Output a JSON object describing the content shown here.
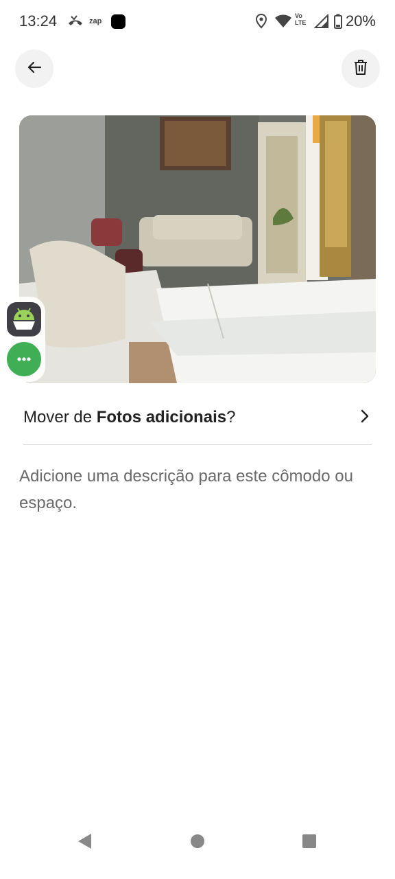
{
  "status_bar": {
    "time": "13:24",
    "notif_icons": [
      "missed-call-icon",
      "zap-icon",
      "app-square-icon"
    ],
    "zap_label": "zap",
    "system_icons": [
      "location-icon",
      "wifi-icon",
      "volte-icon",
      "signal-icon",
      "battery-icon"
    ],
    "volte_top": "Vo",
    "volte_bottom": "LTE",
    "battery": "20%"
  },
  "toolbar": {
    "back_icon": "arrow-left-icon",
    "delete_icon": "trash-icon"
  },
  "photo": {
    "subject": "living room photo"
  },
  "floating": {
    "app_icon": "android-app-icon",
    "menu_icon": "more-dots-icon"
  },
  "move": {
    "prefix": "Mover de ",
    "album": "Fotos adicionais",
    "suffix": "?",
    "icon": "chevron-right-icon"
  },
  "description": {
    "placeholder": "Adicione uma descrição para este cômodo ou espaço."
  },
  "navbar": {
    "back": "nav-back-icon",
    "home": "nav-home-icon",
    "recents": "nav-recents-icon"
  }
}
